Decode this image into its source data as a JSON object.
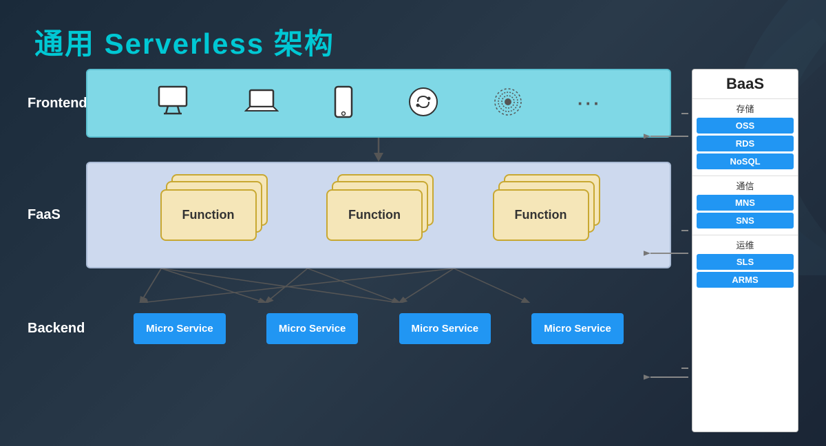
{
  "page": {
    "title": "通用 Serverless 架构",
    "background_color": "#1e2d3d"
  },
  "labels": {
    "frontend": "Frontend",
    "faas": "FaaS",
    "backend": "Backend"
  },
  "frontend": {
    "icons": [
      "🖥",
      "💻",
      "📱",
      "⊙",
      "❋",
      "…"
    ]
  },
  "faas": {
    "function_label": "Function",
    "groups": [
      {
        "id": "f1",
        "label": "Function"
      },
      {
        "id": "f2",
        "label": "Function"
      },
      {
        "id": "f3",
        "label": "Function"
      }
    ]
  },
  "backend": {
    "services": [
      {
        "id": "ms1",
        "label": "Micro Service"
      },
      {
        "id": "ms2",
        "label": "Micro Service"
      },
      {
        "id": "ms3",
        "label": "Micro Service"
      },
      {
        "id": "ms4",
        "label": "Micro Service"
      }
    ]
  },
  "baas": {
    "title": "BaaS",
    "groups": [
      {
        "title": "存储",
        "items": [
          "OSS",
          "RDS",
          "NoSQL"
        ]
      },
      {
        "title": "通信",
        "items": [
          "MNS",
          "SNS"
        ]
      },
      {
        "title": "运维",
        "items": [
          "SLS",
          "ARMS"
        ]
      }
    ]
  }
}
